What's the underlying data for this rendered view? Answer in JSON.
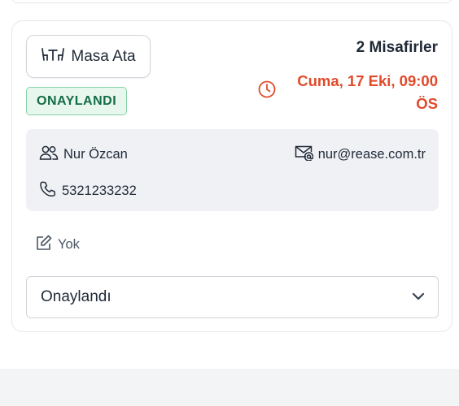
{
  "reservation": {
    "assign_table_label": "Masa Ata",
    "status_badge": "ONAYLANDI",
    "guests": "2 Misafirler",
    "date_line1": "Cuma, 17 Eki, 09:00",
    "date_line2": "ÖS",
    "customer_name": "Nur Özcan",
    "email": "nur@rease.com.tr",
    "phone": "5321233232",
    "note": "Yok",
    "status_select_value": "Onaylandı"
  },
  "icons": {
    "assign_table": "table-icon",
    "time": "clock-icon",
    "customer": "users-icon",
    "email": "envelope-at-icon",
    "phone": "telephone-icon",
    "note": "pencil-square-icon",
    "select": "chevron-down-icon"
  },
  "colors": {
    "accent_date": "#e04b2c",
    "badge_text": "#146c43",
    "badge_bg": "#e8f7ee",
    "badge_border": "#86d2a7",
    "info_bg": "#f0f1f4"
  }
}
